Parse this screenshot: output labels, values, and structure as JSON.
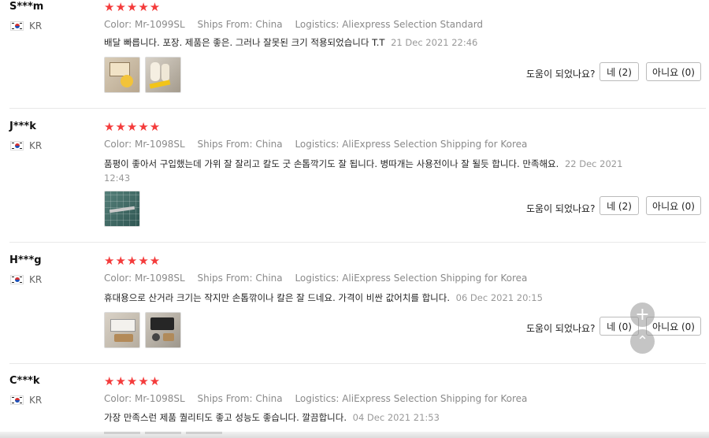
{
  "labels": {
    "helpful": "도움이 되었나요?",
    "stars": "★★★★★"
  },
  "reviews": [
    {
      "user": "S***m",
      "country": "KR",
      "color": "Color: Mr-1099SL",
      "ships": "Ships From: China",
      "logistics": "Logistics: Aliexpress Selection Standard",
      "text": "배달 빠릅니다. 포장. 제품은 좋은. 그러나 잘못된 크기 적용되었습니다 T.T",
      "date": "21 Dec 2021 22:46",
      "yes": "네 (2)",
      "no": "아니요 (0)"
    },
    {
      "user": "J***k",
      "country": "KR",
      "color": "Color: Mr-1098SL",
      "ships": "Ships From: China",
      "logistics": "Logistics: AliExpress Selection Shipping for Korea",
      "text": "품평이 좋아서 구입했는데 가위 잘 잘리고 칼도 굿 손톱깍기도 잘 됩니다. 병따개는 사용전이나 잘 될듯 합니다. 만족해요.",
      "date": "22 Dec 2021 12:43",
      "yes": "네 (2)",
      "no": "아니요 (0)"
    },
    {
      "user": "H***g",
      "country": "KR",
      "color": "Color: Mr-1098SL",
      "ships": "Ships From: China",
      "logistics": "Logistics: AliExpress Selection Shipping for Korea",
      "text": "휴대용으로 산거라 크기는 작지만 손톱깎이나 칼은 잘 드네요. 가격이 비싼 값어치를 합니다.",
      "date": "06 Dec 2021 20:15",
      "yes": "네 (0)",
      "no": "아니요 (0)"
    },
    {
      "user": "C***k",
      "country": "KR",
      "color": "Color: Mr-1098SL",
      "ships": "Ships From: China",
      "logistics": "Logistics: AliExpress Selection Shipping for Korea",
      "text": "가장 만족스런 제품 퀄리티도 좋고 성능도 좋습니다. 깔끔합니다.",
      "date": "04 Dec 2021 21:53"
    }
  ],
  "icons": {
    "plus": "+",
    "up": "⌃"
  }
}
